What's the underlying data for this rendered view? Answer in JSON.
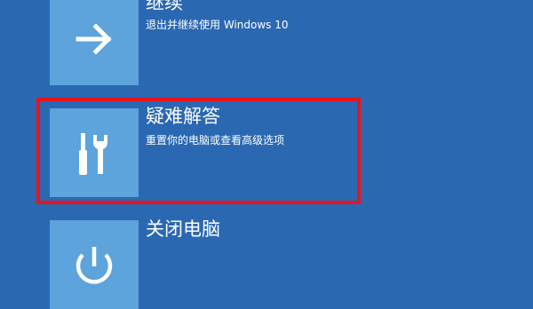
{
  "options": [
    {
      "title": "继续",
      "subtitle": "退出并继续使用 Windows 10",
      "icon": "arrow-right-icon"
    },
    {
      "title": "疑难解答",
      "subtitle": "重置你的电脑或查看高级选项",
      "icon": "tools-icon"
    },
    {
      "title": "关闭电脑",
      "subtitle": "",
      "icon": "power-icon"
    }
  ],
  "colors": {
    "background": "#2a68b2",
    "tile": "#5da3dc",
    "text": "#ffffff",
    "highlight": "#e8141c"
  }
}
